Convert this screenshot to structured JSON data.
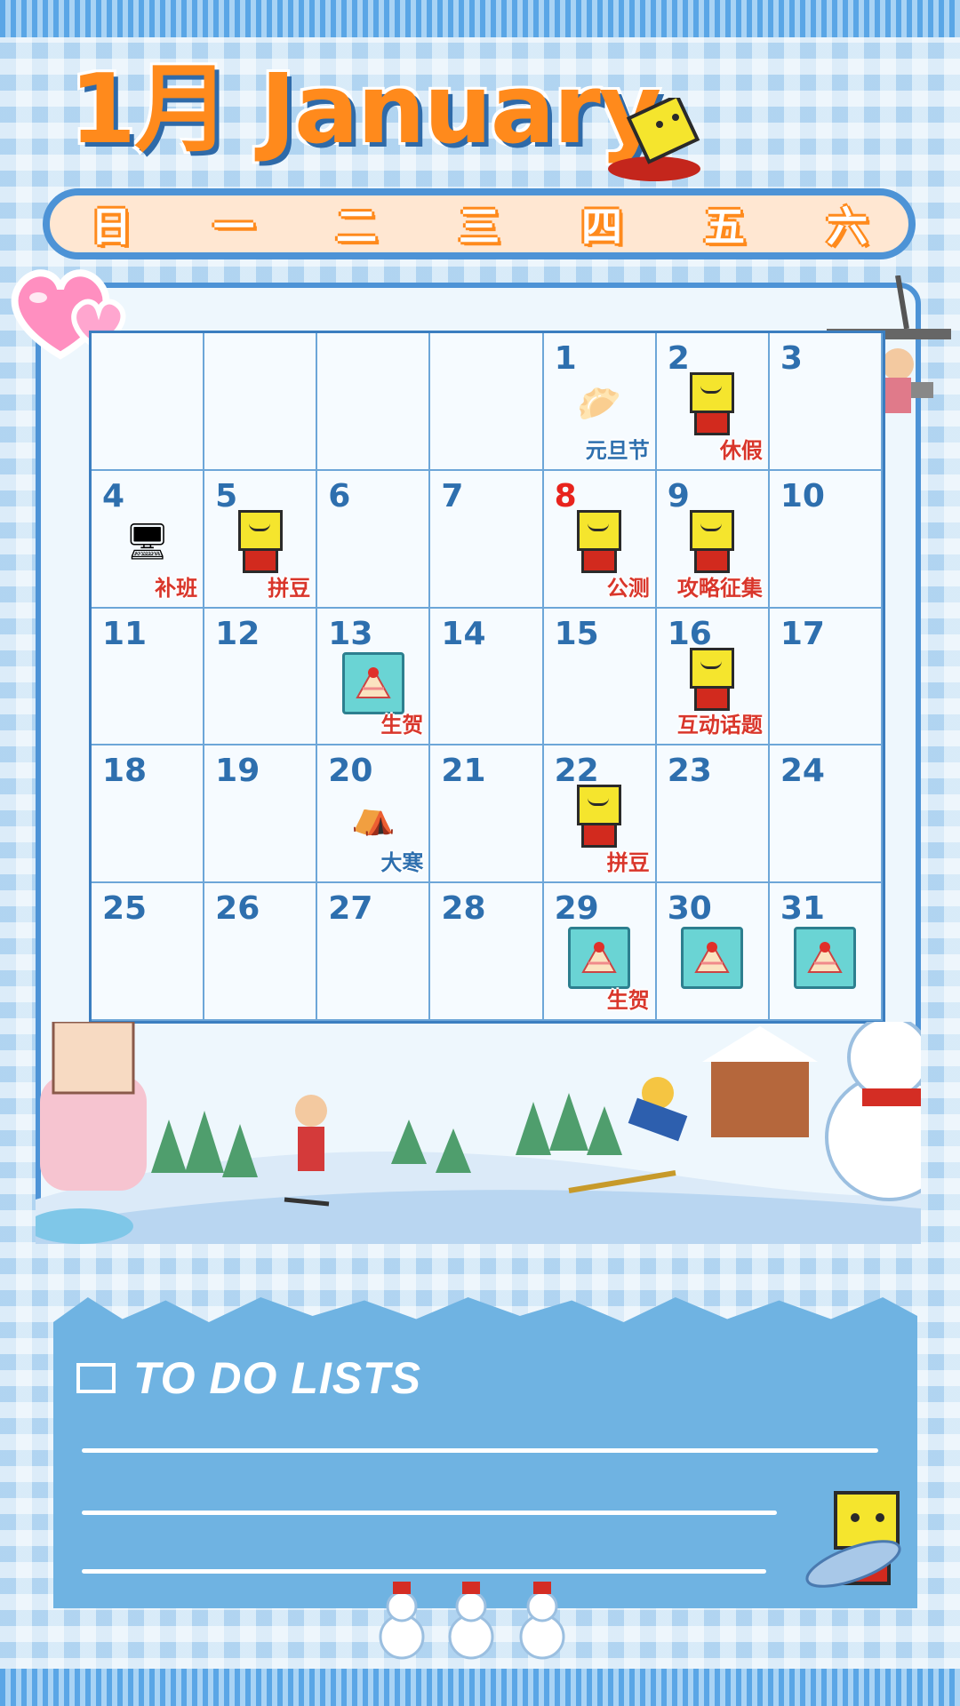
{
  "header": {
    "title": "1月 January"
  },
  "weekdays": [
    "日",
    "一",
    "二",
    "三",
    "四",
    "五",
    "六"
  ],
  "calendar": {
    "cells": [
      {
        "day": ""
      },
      {
        "day": ""
      },
      {
        "day": ""
      },
      {
        "day": ""
      },
      {
        "day": "1",
        "event": "元旦节",
        "event_color": "blue",
        "icon": "bun-mascot-icon"
      },
      {
        "day": "2",
        "event": "休假",
        "icon": "sleeping-kairobot-icon"
      },
      {
        "day": "3"
      },
      {
        "day": "4",
        "event": "补班",
        "icon": "office-desk-icon"
      },
      {
        "day": "5",
        "event": "拼豆",
        "icon": "kairobot-music-icon"
      },
      {
        "day": "6"
      },
      {
        "day": "7"
      },
      {
        "day": "8",
        "day_color": "red",
        "event": "公测",
        "icon": "kairobot-app-icon"
      },
      {
        "day": "9",
        "event": "攻略征集",
        "icon": "kairobot-glasses-icon"
      },
      {
        "day": "10"
      },
      {
        "day": "11"
      },
      {
        "day": "12"
      },
      {
        "day": "13",
        "event": "生贺",
        "icon": "birthday-cake-icon"
      },
      {
        "day": "14"
      },
      {
        "day": "15"
      },
      {
        "day": "16",
        "event": "互动话题",
        "icon": "kairobot-wave-icon"
      },
      {
        "day": "17"
      },
      {
        "day": "18"
      },
      {
        "day": "19"
      },
      {
        "day": "20",
        "event": "大寒",
        "event_color": "blue",
        "icon": "kairobot-tent-icon"
      },
      {
        "day": "21"
      },
      {
        "day": "22",
        "event": "拼豆",
        "icon": "kairobot-icon"
      },
      {
        "day": "23"
      },
      {
        "day": "24"
      },
      {
        "day": "25"
      },
      {
        "day": "26"
      },
      {
        "day": "27"
      },
      {
        "day": "28"
      },
      {
        "day": "29",
        "event": "生贺",
        "icon": "birthday-cake-icon"
      },
      {
        "day": "30",
        "icon": "birthday-cake-icon"
      },
      {
        "day": "31",
        "icon": "birthday-cake-icon"
      }
    ]
  },
  "todo": {
    "title": "TO DO LISTS",
    "line_count": 3
  },
  "colors": {
    "accent_orange": "#ff8a1c",
    "primary_blue": "#2e6fae",
    "event_red": "#d9362b",
    "todo_blue": "#6fb3e2"
  }
}
